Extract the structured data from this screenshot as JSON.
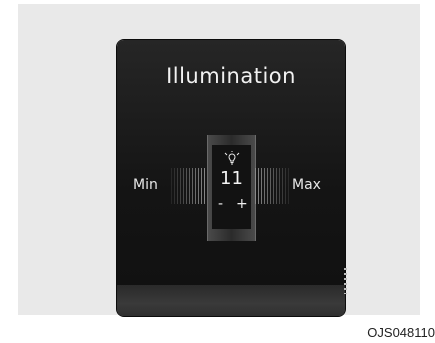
{
  "illumination": {
    "title": "Illumination",
    "min_label": "Min",
    "max_label": "Max",
    "value": "11",
    "minus_label": "-",
    "plus_label": "+",
    "icon": "bulb-icon"
  },
  "footer": {
    "code": "OJS048110"
  },
  "colors": {
    "panel": "#141414",
    "text": "#f2f2f2",
    "frame": "#e9e9e9"
  }
}
